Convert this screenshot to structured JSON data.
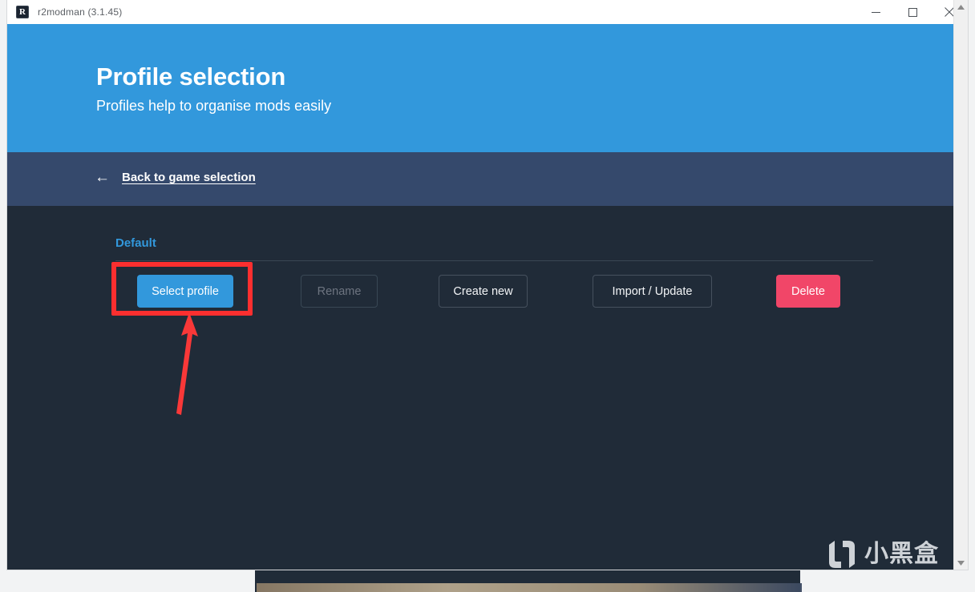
{
  "window": {
    "title": "r2modman (3.1.45)",
    "icon_letter": "R",
    "controls": {
      "minimize": "minimize-icon",
      "maximize": "maximize-icon",
      "close": "close-icon"
    }
  },
  "hero": {
    "title": "Profile selection",
    "subtitle": "Profiles help to organise mods easily",
    "background_color": "#3298dc"
  },
  "nav": {
    "back_label": "Back to game selection",
    "back_icon": "arrow-left-icon",
    "background_color": "#35496c"
  },
  "main": {
    "background_color": "#202b38",
    "profile_name": "Default",
    "profile_name_color": "#3298dc",
    "buttons": [
      {
        "label": "Select profile",
        "style": "primary",
        "color": "#3298dc",
        "disabled": false
      },
      {
        "label": "Rename",
        "style": "disabled",
        "color": "#6d7480",
        "disabled": true
      },
      {
        "label": "Create new",
        "style": "outline",
        "color": "#f3f5f7",
        "disabled": false
      },
      {
        "label": "Import / Update",
        "style": "outline",
        "color": "#f3f5f7",
        "disabled": false
      },
      {
        "label": "Delete",
        "style": "danger",
        "color": "#f14668",
        "disabled": false
      }
    ]
  },
  "annotation": {
    "highlight_color": "#fc2f2f",
    "highlight_target": "Select profile",
    "arrow_icon": "arrow-up-annotation"
  },
  "watermark": {
    "text": "小黑盒",
    "logo_icon": "heybox-logo-icon",
    "color": "#e6eaee"
  },
  "scrollbar": {
    "up_icon": "scroll-up-arrow-icon",
    "down_icon": "scroll-down-arrow-icon",
    "orientation": "vertical"
  }
}
